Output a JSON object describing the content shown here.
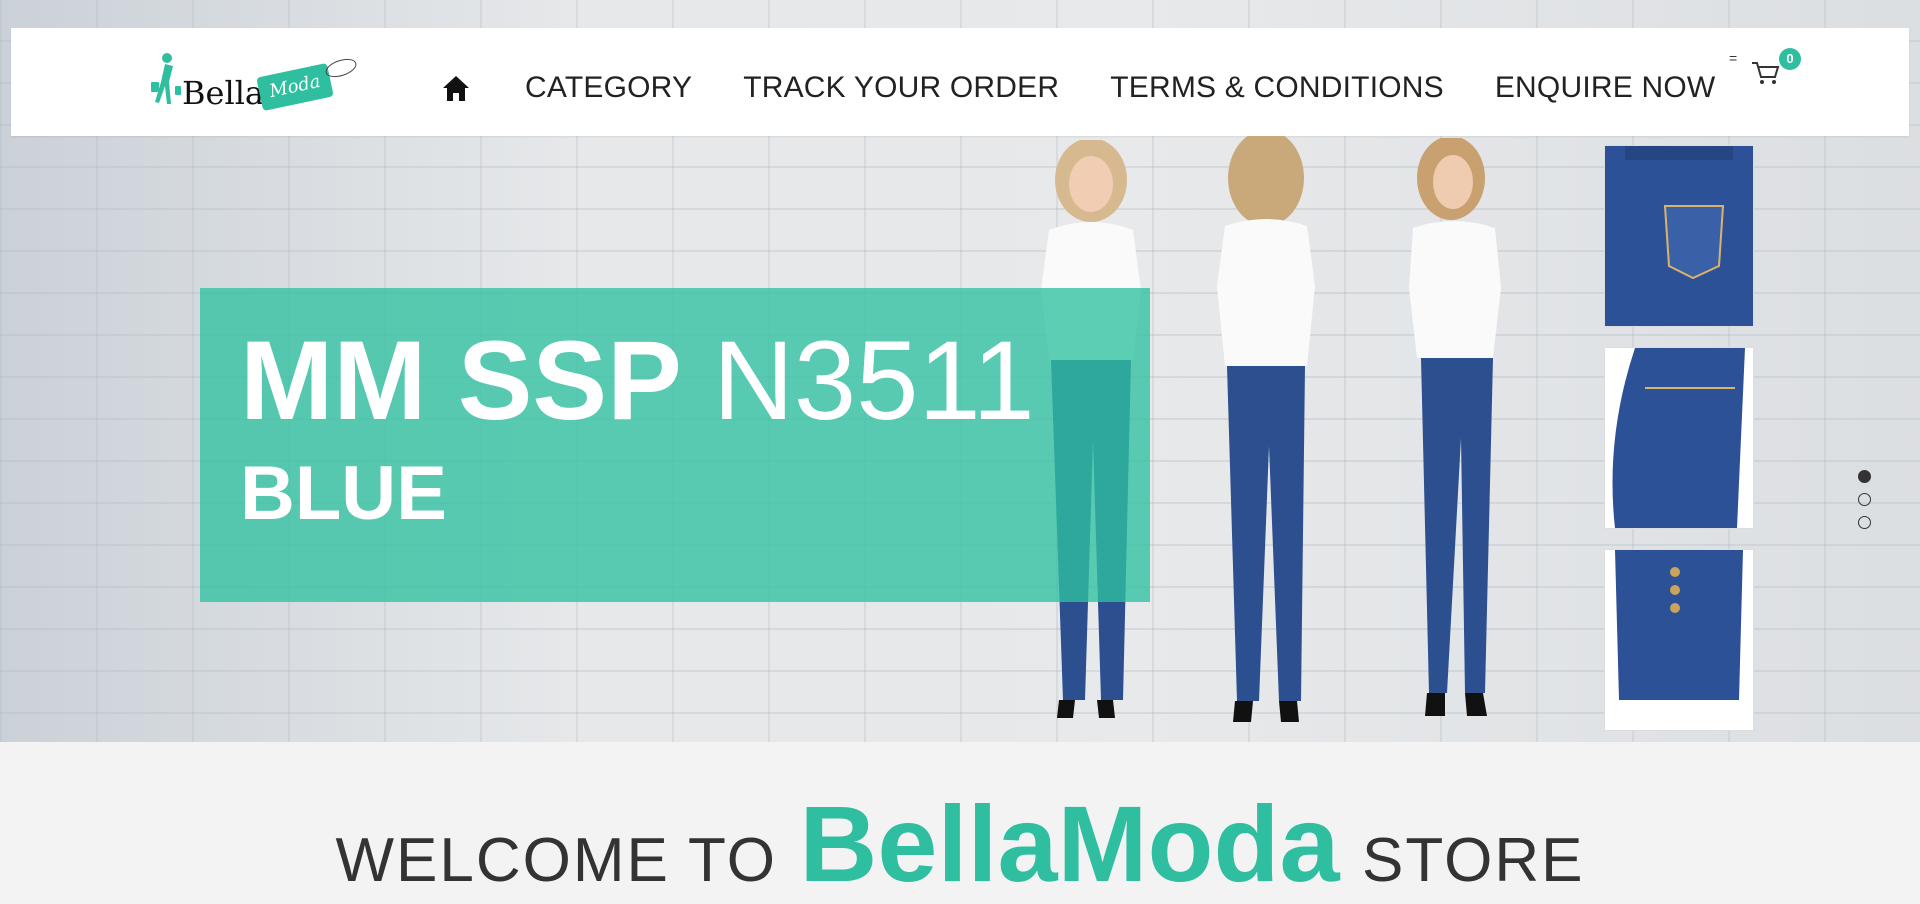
{
  "brand": {
    "name": "Bella",
    "tag": "Moda"
  },
  "nav": {
    "home_icon": "home-icon",
    "items": [
      "CATEGORY",
      "TRACK YOUR ORDER",
      "TERMS & CONDITIONS",
      "ENQUIRE NOW"
    ]
  },
  "menu_toggle": "=",
  "cart": {
    "icon": "cart-icon",
    "count": "0"
  },
  "hero": {
    "headline_bold": "MM SSP",
    "headline_regular": "N3511",
    "subline": "BLUE",
    "slides": 3,
    "active_slide": 1
  },
  "welcome": {
    "prefix": "WELCOME TO",
    "brand": "BellaModa",
    "suffix": "STORE"
  },
  "colors": {
    "accent": "#2fbfa0",
    "denim": "#2c4f8f",
    "text": "#222222"
  }
}
